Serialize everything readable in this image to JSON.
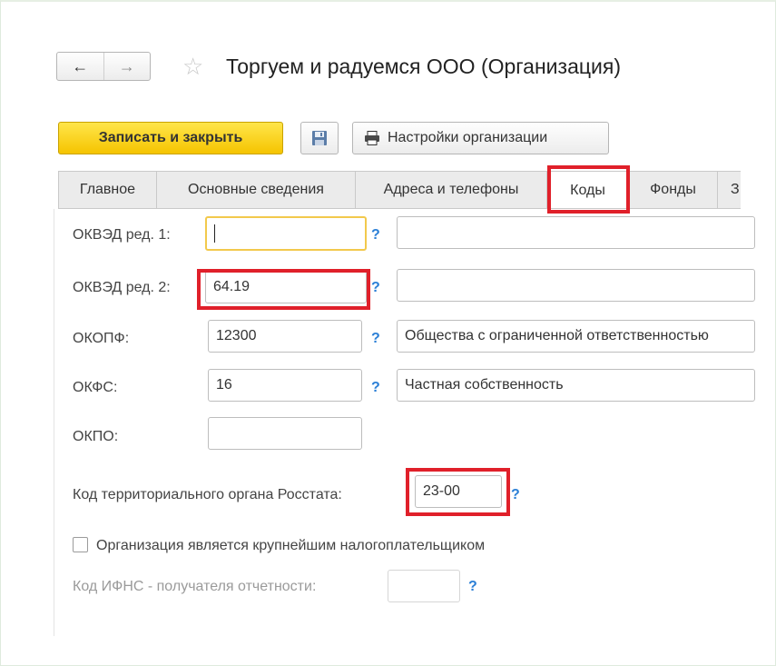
{
  "window": {
    "title": "Торгуем и радуемся ООО (Организация)"
  },
  "nav": {
    "back_icon": "arrow-left",
    "forward_icon": "arrow-right",
    "favorite_icon": "star"
  },
  "toolbar": {
    "save_close_label": "Записать и закрыть",
    "save_icon": "floppy-disk",
    "settings_label": "Настройки организации",
    "settings_icon": "printer"
  },
  "tabs": [
    {
      "label": "Главное"
    },
    {
      "label": "Основные сведения"
    },
    {
      "label": "Адреса и телефоны"
    },
    {
      "label": "Коды",
      "active": true
    },
    {
      "label": "Фонды"
    },
    {
      "label": "З"
    }
  ],
  "form": {
    "help_symbol": "?",
    "okved1": {
      "label": "ОКВЭД ред. 1:",
      "value": "",
      "description": ""
    },
    "okved2": {
      "label": "ОКВЭД ред. 2:",
      "value": "64.19",
      "description": ""
    },
    "okopf": {
      "label": "ОКОПФ:",
      "value": "12300",
      "description": "Общества с ограниченной ответственностью"
    },
    "okfs": {
      "label": "ОКФС:",
      "value": "16",
      "description": "Частная собственность"
    },
    "okpo": {
      "label": "ОКПО:",
      "value": ""
    },
    "rosstat": {
      "label": "Код территориального органа Росстата:",
      "value": "23-00"
    },
    "largest_taxpayer": {
      "label": "Организация является крупнейшим налогоплательщиком",
      "checked": false
    },
    "ifns": {
      "label": "Код ИФНС - получателя отчетности:",
      "value": ""
    }
  },
  "colors": {
    "primary_button": "#f5c400",
    "highlight": "#e0202a",
    "help": "#2b7fd6",
    "focus": "#f2c94c"
  }
}
